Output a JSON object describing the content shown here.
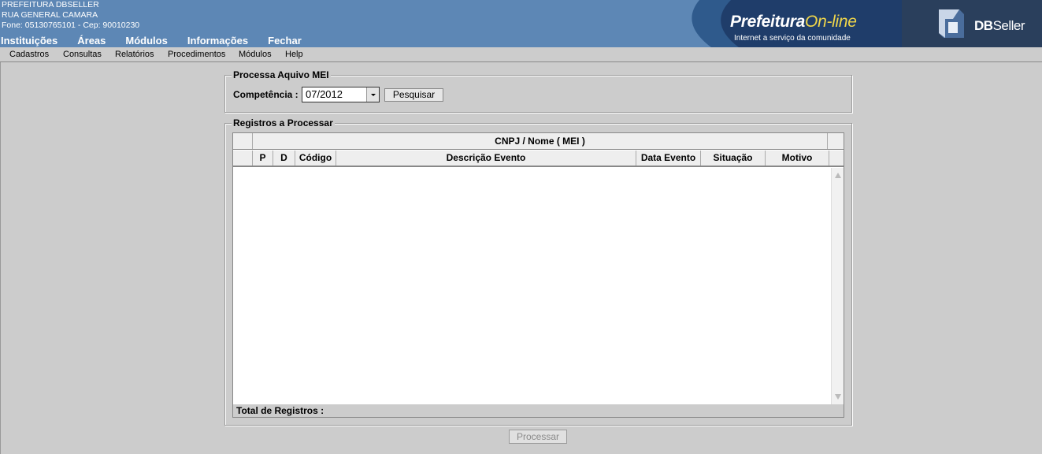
{
  "header": {
    "org_lines": [
      "PREFEITURA DBSELLER",
      "RUA GENERAL CAMARA",
      "Fone: 05130765101  -  Cep: 90010230"
    ],
    "top_menu": [
      "Instituições",
      "Áreas",
      "Módulos",
      "Informações",
      "Fechar"
    ],
    "brand": {
      "prefeitura": "Prefeitura",
      "online": "On-line",
      "tagline": "Internet a serviço da comunidade",
      "dbseller_db": "DB",
      "dbseller_rest": "Seller"
    },
    "colors": {
      "banner": "#5d87b5",
      "brand_dark": "#1f3d6a",
      "online_accent": "#f0d64a"
    }
  },
  "menubar": [
    "Cadastros",
    "Consultas",
    "Relatórios",
    "Procedimentos",
    "Módulos",
    "Help"
  ],
  "processa": {
    "legend": "Processa Aquivo MEI",
    "competencia_label": "Competência :",
    "competencia_value": "07/2012",
    "pesquisar_label": "Pesquisar"
  },
  "registros": {
    "legend": "Registros a Processar",
    "group_header": "CNPJ / Nome ( MEI )",
    "columns": [
      "P",
      "D",
      "Código",
      "Descrição Evento",
      "Data Evento",
      "Situação",
      "Motivo"
    ],
    "rows": [],
    "total_label": "Total de Registros :",
    "total_value": ""
  },
  "processar_label": "Processar"
}
